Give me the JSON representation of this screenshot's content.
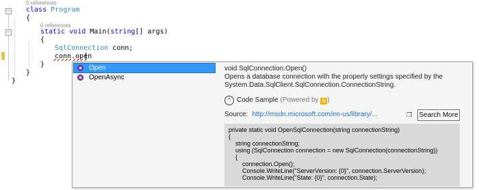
{
  "editor": {
    "references_1": "0 references",
    "line_class": [
      "class",
      " Program"
    ],
    "open_brace_1": "{",
    "references_2": "0 references",
    "line_main": [
      "static",
      " ",
      "void",
      " Main(",
      "string",
      "[] args)"
    ],
    "open_brace_2": "{",
    "line_decl": [
      "SqlConnection",
      " conn;"
    ],
    "line_typed": "conn.open",
    "close_brace_2": "}",
    "close_brace_1": "}",
    "close_brace_0": "}"
  },
  "completion": {
    "items": [
      {
        "label": "Open",
        "icon": "method-icon",
        "selected": true
      },
      {
        "label": "OpenAsync",
        "icon": "method-icon",
        "selected": false
      }
    ]
  },
  "tooltip": {
    "signature": "void SqlConnection.Open()",
    "description": "Opens a database connection with the property settings specified by the System.Data.SqlClient.SqlConnection.ConnectionString.",
    "code_sample_title": "Code Sample",
    "powered_by": "(Powered by",
    "powered_by_close": ")",
    "bing_icon": "bing-icon",
    "source_label": "Source:",
    "source_url": "http://msdn.microsoft.com/en-us/library/...",
    "search_more": "Search More",
    "code_lines": [
      "private static void OpenSqlConnection(string connectionString)",
      "{",
      "    string connectionString;",
      "    using (SqlConnection connection = new SqlConnection(connectionString))",
      "    {",
      "        connection.Open();",
      "        Console.WriteLine(\"ServerVersion: {0}\", connection.ServerVersion);",
      "        Console.WriteLine(\"State: {0}\", connection.State);"
    ]
  },
  "colors": {
    "keyword": "#0000ff",
    "type": "#2b91af",
    "selection": "#3399ff",
    "link": "#1e6ec8"
  }
}
